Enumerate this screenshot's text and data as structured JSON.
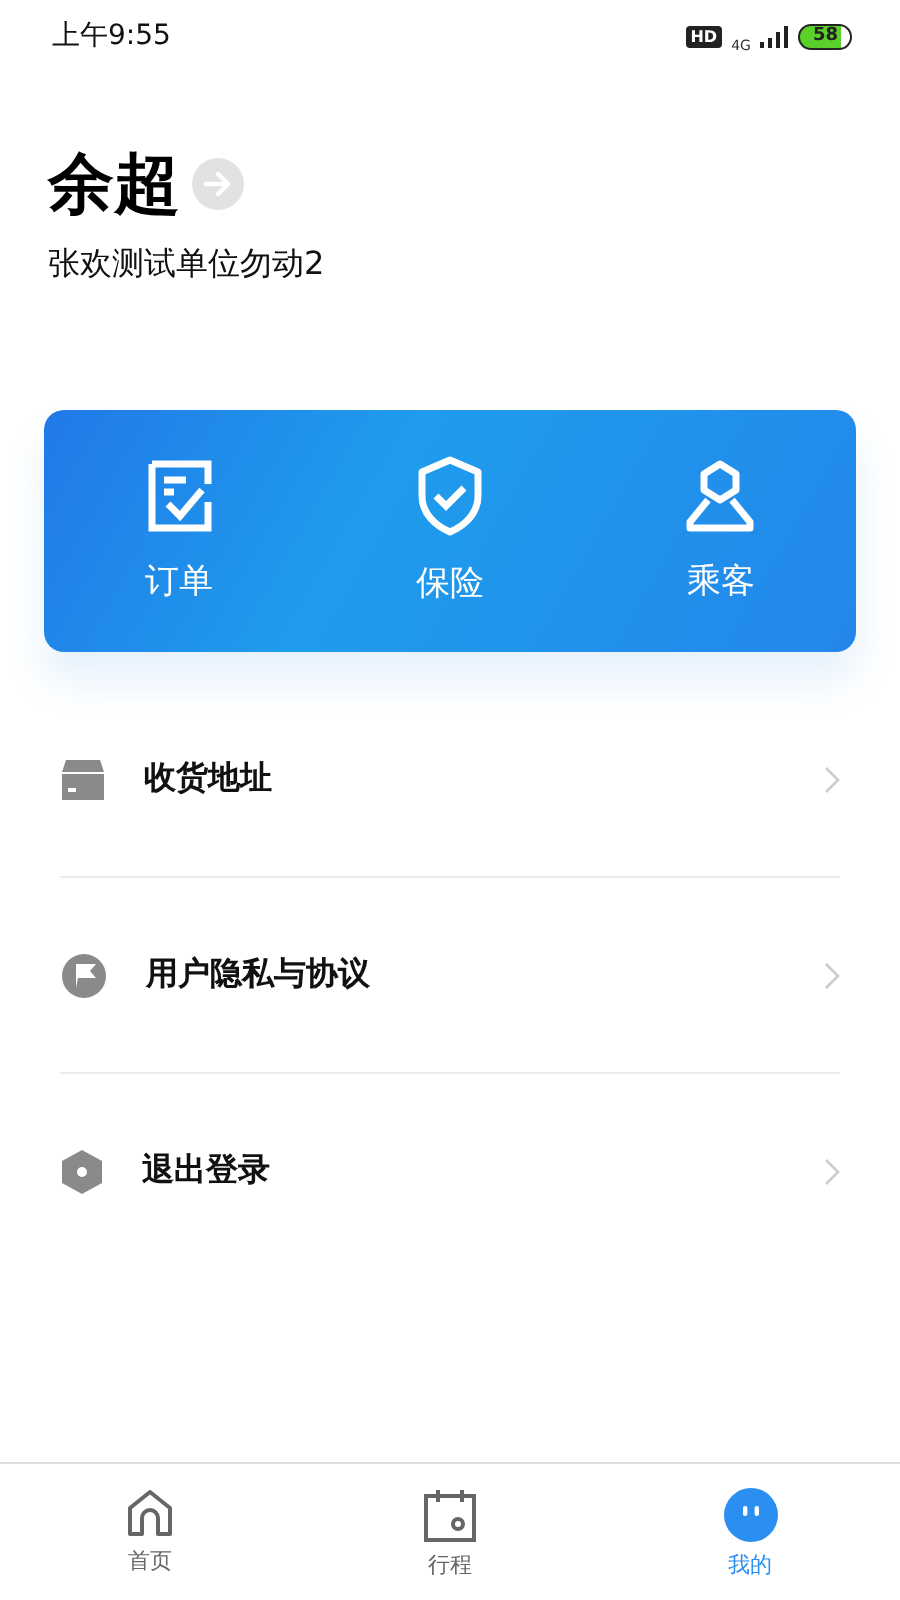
{
  "status_bar": {
    "time": "上午9:55",
    "hd": "HD",
    "network": "4G",
    "battery": "58"
  },
  "profile": {
    "name": "余超",
    "company": "张欢测试单位勿动2"
  },
  "quick_actions": [
    {
      "kind": "order",
      "label": "订单"
    },
    {
      "kind": "insurance",
      "label": "保险"
    },
    {
      "kind": "passenger",
      "label": "乘客"
    }
  ],
  "menu": [
    {
      "kind": "box",
      "label": "收货地址"
    },
    {
      "kind": "flag",
      "label": "用户隐私与协议"
    },
    {
      "kind": "hexagon",
      "label": "退出登录"
    }
  ],
  "tabs": [
    {
      "kind": "home",
      "label": "首页",
      "selected": false
    },
    {
      "kind": "calendar",
      "label": "行程",
      "selected": false
    },
    {
      "kind": "me",
      "label": "我的",
      "selected": true
    }
  ]
}
